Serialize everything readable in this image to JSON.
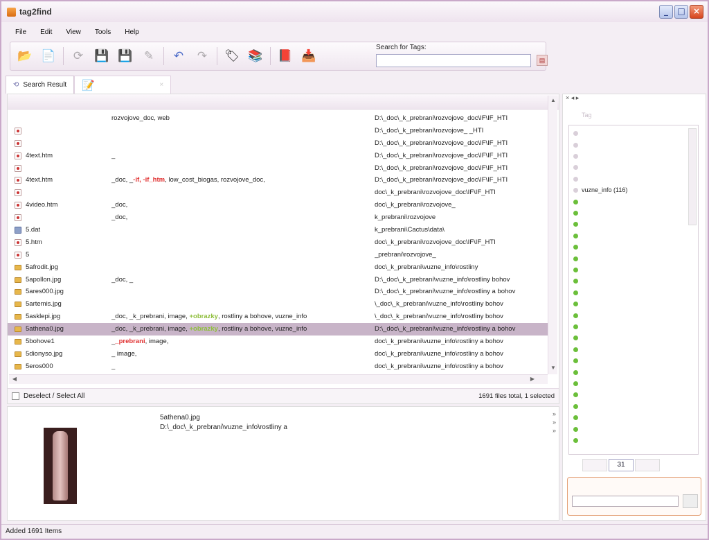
{
  "window": {
    "title": "tag2find"
  },
  "menu": [
    "File",
    "Edit",
    "View",
    "Tools",
    "Help"
  ],
  "toolbar": {
    "icons": [
      "open-folder-icon",
      "new-document-icon",
      "refresh-icon",
      "save-icon",
      "save-all-icon",
      "edit-icon",
      "undo-icon",
      "redo-icon",
      "tag-icon",
      "tags-icon",
      "export-icon",
      "import-icon"
    ],
    "search_label": "Search for Tags:",
    "search_value": ""
  },
  "tabs": [
    {
      "label": "Search Result"
    },
    {
      "label": ""
    }
  ],
  "files": [
    {
      "name": "",
      "type": "none",
      "tags": "rozvojove_doc, web",
      "path": "D:\\_doc\\_k_prebrani\\rozvojove_doc\\IF\\IF_HTI",
      "selected": false
    },
    {
      "name": "",
      "type": "htm",
      "tags": "",
      "path": "D:\\_doc\\_k_prebrani\\rozvojove_        _HTI",
      "selected": false
    },
    {
      "name": "",
      "type": "htm",
      "tags": "",
      "path": "D:\\_doc\\_k_prebrani\\rozvojove_doc\\IF\\IF_HTI",
      "selected": false
    },
    {
      "name": "4text.htm",
      "type": "htm",
      "tags": "_",
      "path": "D:\\_doc\\_k_prebrani\\rozvojove_doc\\IF\\IF_HTI",
      "selected": false
    },
    {
      "name": "",
      "type": "htm",
      "tags": "",
      "path": "D:\\_doc\\_k_prebrani\\rozvojove_doc\\IF\\IF_HTI",
      "selected": false
    },
    {
      "name": "4text.htm",
      "type": "htm",
      "tags": "_doc, _",
      "tags_red": "-if, -if_htm",
      "tags_after": ", low_cost_biogas, rozvojove_doc,",
      "path": "D:\\_doc\\_k_prebrani\\rozvojove_doc\\IF\\IF_HTI",
      "selected": false
    },
    {
      "name": "",
      "type": "htm",
      "tags": "",
      "path": "doc\\_k_prebrani\\rozvojove_doc\\IF\\IF_HTI",
      "selected": false
    },
    {
      "name": "4video.htm",
      "type": "htm",
      "tags": "_doc,",
      "path": "doc\\_k_prebrani\\rozvojove_",
      "selected": false
    },
    {
      "name": "",
      "type": "htm",
      "tags": "_doc,",
      "path": "k_prebrani\\rozvojove",
      "selected": false
    },
    {
      "name": "5.dat",
      "type": "dat",
      "tags": "",
      "path": "k_prebrani\\Cactus\\data\\",
      "selected": false
    },
    {
      "name": "5.htm",
      "type": "htm",
      "tags": "",
      "path": "doc\\_k_prebrani\\rozvojove_doc\\IF\\IF_HTI",
      "selected": false
    },
    {
      "name": "5",
      "type": "htm",
      "tags": "",
      "path": "_prebrani\\rozvojove_",
      "selected": false
    },
    {
      "name": "5afrodit.jpg",
      "type": "jpg",
      "tags": "",
      "path": "doc\\_k_prebrani\\vuzne_info\\rostliny",
      "selected": false
    },
    {
      "name": "5apollon.jpg",
      "type": "jpg",
      "tags": "_doc, _",
      "path": "D:\\_doc\\_k_prebrani\\vuzne_info\\rostliny   bohov",
      "selected": false
    },
    {
      "name": "5ares000.jpg",
      "type": "jpg",
      "tags": "",
      "path": "D:\\_doc\\_k_prebrani\\vuzne_info\\rostliny a bohov",
      "selected": false
    },
    {
      "name": "5artemis.jpg",
      "type": "jpg",
      "tags": "",
      "path": "\\_doc\\_k_prebrani\\vuzne_info\\rostliny   bohov",
      "selected": false
    },
    {
      "name": "5asklepi.jpg",
      "type": "jpg",
      "tags": "_doc, _k_prebrani, image, ",
      "tags_grn": "+obrazky",
      "tags_after": ", rostliny a bohove, vuzne_info",
      "path": "\\_doc\\_k_prebrani\\vuzne_info\\rostliny   bohov",
      "selected": false
    },
    {
      "name": "5athena0.jpg",
      "type": "jpg",
      "tags": "_doc, _k_prebrani, image, ",
      "tags_grn": "+obrazky",
      "tags_after": ", rostliny a bohove, vuzne_info",
      "path": "D:\\_doc\\_k_prebrani\\vuzne_info\\rostliny a bohov",
      "selected": true
    },
    {
      "name": "5bohove1",
      "type": "jpg",
      "tags": "_",
      "tags_red": "_prebrani",
      "tags_after": ", image, ",
      "path": "doc\\_k_prebrani\\vuzne_info\\rostliny a bohov",
      "selected": false
    },
    {
      "name": "5dionyso.jpg",
      "type": "jpg",
      "tags": "_        image,",
      "path": "doc\\_k_prebrani\\vuzne_info\\rostliny a bohov",
      "selected": false
    },
    {
      "name": "5eros000",
      "type": "jpg",
      "tags": "_",
      "path": "doc\\_k_prebrani\\vuzne_info\\rostliny a bohov",
      "selected": false
    }
  ],
  "status": {
    "deselect_label": "Deselect / Select All",
    "file_count": "1691 files total, 1 selected"
  },
  "preview": {
    "name": "5athena0.jpg",
    "path": "D:\\_doc\\_k_prebrani\\vuzne_info\\rostliny a"
  },
  "tagpane": {
    "header": "Tag",
    "tags": [
      {
        "label": "",
        "active": false
      },
      {
        "label": "",
        "active": false
      },
      {
        "label": "",
        "active": false
      },
      {
        "label": "",
        "active": false
      },
      {
        "label": "",
        "active": false
      },
      {
        "label": "vuzne_info (116)",
        "active": false,
        "highlight": true
      },
      {
        "label": "",
        "active": true
      },
      {
        "label": "",
        "active": true
      },
      {
        "label": "",
        "active": true
      },
      {
        "label": "",
        "active": true
      },
      {
        "label": "",
        "active": true
      },
      {
        "label": "",
        "active": true
      },
      {
        "label": "",
        "active": true
      },
      {
        "label": "",
        "active": true
      },
      {
        "label": "",
        "active": true
      },
      {
        "label": "",
        "active": true
      },
      {
        "label": "",
        "active": true
      },
      {
        "label": "",
        "active": true
      },
      {
        "label": "",
        "active": true
      },
      {
        "label": "",
        "active": true
      },
      {
        "label": "",
        "active": true
      },
      {
        "label": "",
        "active": true
      },
      {
        "label": "",
        "active": true
      },
      {
        "label": "",
        "active": true
      },
      {
        "label": "",
        "active": true
      },
      {
        "label": "",
        "active": true
      },
      {
        "label": "",
        "active": true
      },
      {
        "label": "",
        "active": true
      }
    ],
    "bottom_tabs": [
      "",
      "31",
      ""
    ]
  },
  "statusbar": {
    "text": "Added 1691 Items"
  }
}
